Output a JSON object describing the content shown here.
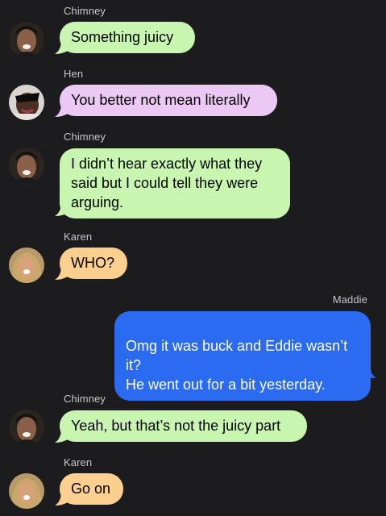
{
  "colors": {
    "background": "#1c1c1e",
    "chimney_bubble": "#c8f5b0",
    "hen_bubble": "#ecc8f4",
    "karen_bubble": "#fbd08e",
    "maddie_bubble": "#2a6bf2"
  },
  "messages": [
    {
      "sender": "Chimney",
      "text": "Something juicy",
      "direction": "incoming"
    },
    {
      "sender": "Hen",
      "text": "You better not mean literally",
      "direction": "incoming"
    },
    {
      "sender": "Chimney",
      "text": "I didn’t hear exactly what they said but I could tell they were arguing.",
      "direction": "incoming"
    },
    {
      "sender": "Karen",
      "text": "WHO?",
      "direction": "incoming"
    },
    {
      "sender": "Maddie",
      "text": "Omg it was buck and Eddie wasn’t it?\nHe went out for a bit yesterday.",
      "direction": "outgoing"
    },
    {
      "sender": "Chimney",
      "text": "Yeah, but that’s not the juicy part",
      "direction": "incoming"
    },
    {
      "sender": "Karen",
      "text": "Go on",
      "direction": "incoming"
    }
  ],
  "avatars": {
    "chimney": "chimney-avatar",
    "hen": "hen-avatar",
    "karen": "karen-avatar"
  }
}
